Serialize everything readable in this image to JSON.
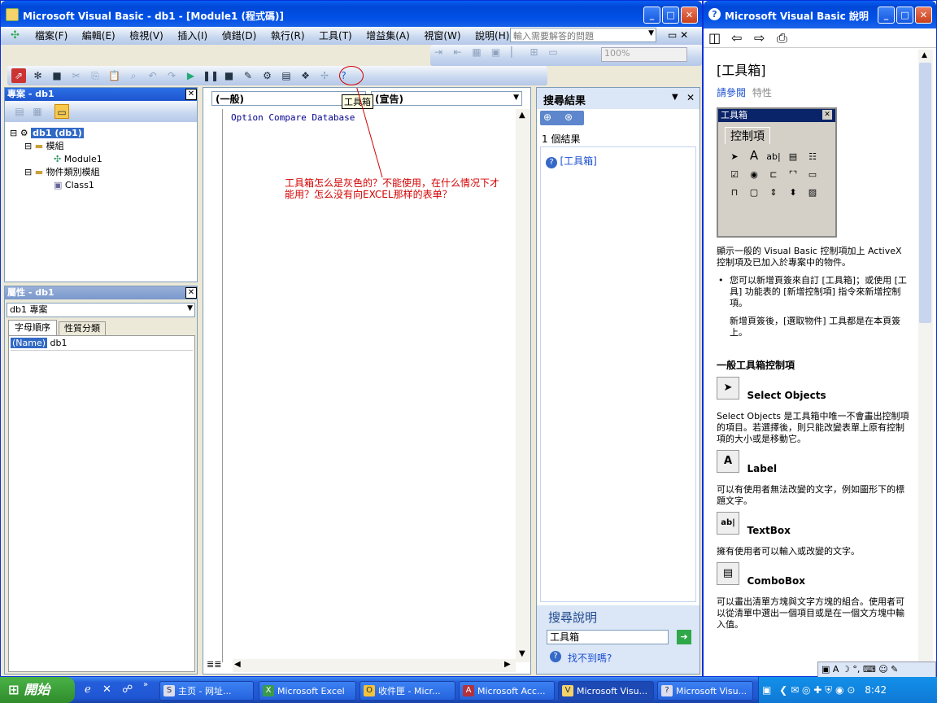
{
  "vb_window": {
    "title": "Microsoft Visual Basic - db1 - [Module1 (程式碼)]",
    "min_label": "_",
    "max_label": "□",
    "close_label": "✕",
    "menus": [
      "檔案(F)",
      "編輯(E)",
      "檢視(V)",
      "插入(I)",
      "偵錯(D)",
      "執行(R)",
      "工具(T)",
      "增益集(A)",
      "視窗(W)",
      "說明(H)"
    ],
    "question_placeholder": "輸入需要解答的問題",
    "zoom": "100%",
    "tooltip": "工具箱",
    "code_window_minmax": "▭ ✕"
  },
  "project_panel": {
    "title": "專案 - db1",
    "tree": {
      "root": "db1 (db1)",
      "modules_folder": "模組",
      "module1": "Module1",
      "class_folder": "物件類別模組",
      "class1": "Class1"
    }
  },
  "properties_panel": {
    "title": "屬性 - db1",
    "object_select": "db1 專案",
    "tab_alpha": "字母順序",
    "tab_category": "性質分類",
    "prop_name": "(Name)",
    "prop_value": "db1"
  },
  "code_pane": {
    "object_combo": "(一般)",
    "proc_combo": "(宣告)",
    "code_line": "Option Compare Database",
    "annotation_line1": "工具箱怎么是灰色的？不能使用，在什么情况下才",
    "annotation_line2": "能用？怎么没有向EXCEL那样的表单？",
    "annotation_color": "#d40000"
  },
  "search_panel": {
    "title": "搜尋結果",
    "result_count": "1 個結果",
    "result_item": "[工具箱]",
    "search_help_title": "搜尋說明",
    "search_value": "工具箱",
    "not_found_link": "找不到嗎?"
  },
  "help_window": {
    "title": "Microsoft Visual Basic 說明",
    "page_heading": "[工具箱]",
    "see_also": "請參閱",
    "properties_link": "特性",
    "toolbox_title": "工具箱",
    "toolbox_tab": "控制項",
    "intro": "顯示一般的 Visual Basic 控制項加上 ActiveX 控制項及已加入於專案中的物件。",
    "bullet_a": "您可以新增頁簽來自訂 [工具箱]；或使用 [工具] 功能表的 [新增控制項] 指令來新增控制項。",
    "bullet_b": "新增頁簽後，[選取物件] 工具都是在本頁簽上。",
    "section_heading": "一般工具箱控制項",
    "controls": [
      {
        "name": "Select Objects",
        "icon": "pointer-icon",
        "glyph": "➤",
        "desc": "Select Objects 是工具箱中唯一不會畫出控制項的項目。若選擇後，則只能改變表單上原有控制項的大小或是移動它。"
      },
      {
        "name": "Label",
        "icon": "label-icon",
        "glyph": "A",
        "desc": "可以有使用者無法改變的文字，例如圖形下的標題文字。"
      },
      {
        "name": "TextBox",
        "icon": "textbox-icon",
        "glyph": "ab|",
        "desc": "擁有使用者可以輸入或改變的文字。"
      },
      {
        "name": "ComboBox",
        "icon": "combobox-icon",
        "glyph": "▤",
        "desc": "可以畫出清單方塊與文字方塊的組合。使用者可以從清單中選出一個項目或是在一個文方塊中輸入值。"
      }
    ]
  },
  "taskbar": {
    "start_label": "開始",
    "items": [
      {
        "label": "主页 - 网址...",
        "icon": "S"
      },
      {
        "label": "Microsoft Excel",
        "icon": "X"
      },
      {
        "label": "收件匣 - Micr...",
        "icon": "O"
      },
      {
        "label": "Microsoft Acc...",
        "icon": "A"
      },
      {
        "label": "Microsoft Visu...",
        "icon": "V"
      },
      {
        "label": "Microsoft Visu...",
        "icon": "?"
      }
    ],
    "clock": "8:42"
  }
}
